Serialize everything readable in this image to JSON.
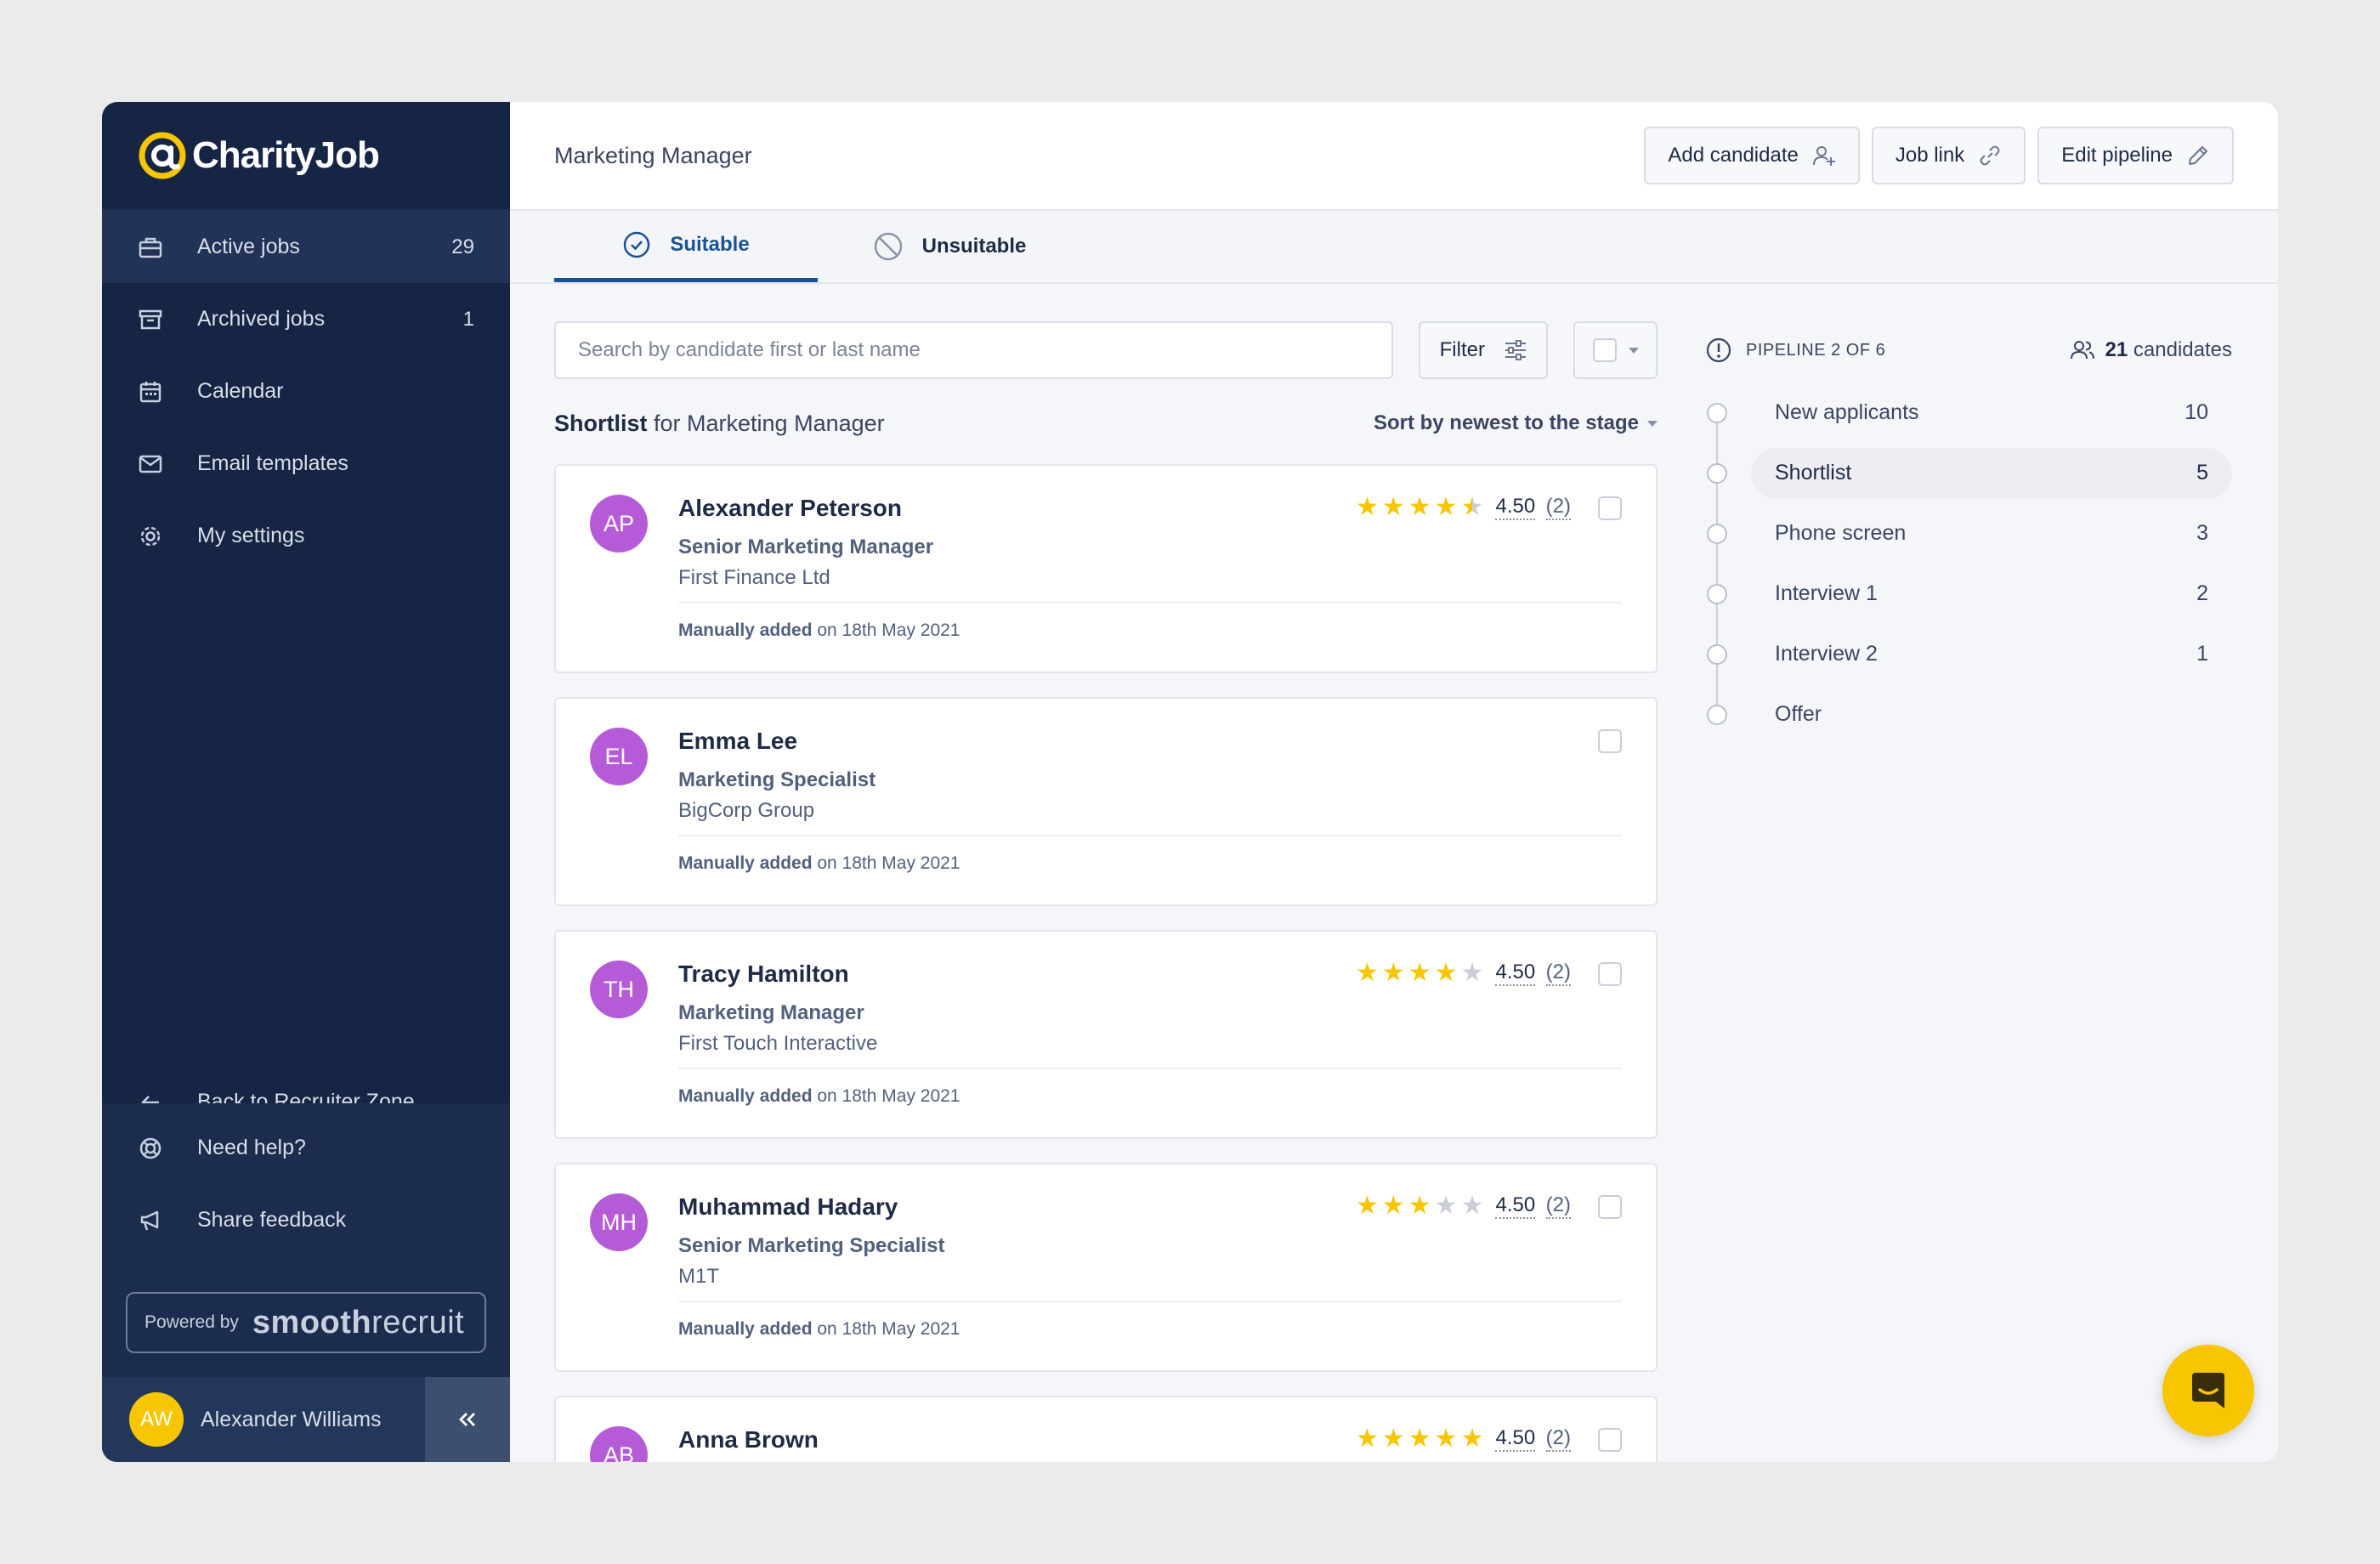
{
  "brand": {
    "name": "CharityJob"
  },
  "sidebar": {
    "items": [
      {
        "label": "Active jobs",
        "count": "29",
        "icon": "briefcase-icon"
      },
      {
        "label": "Archived jobs",
        "count": "1",
        "icon": "archive-icon"
      },
      {
        "label": "Calendar",
        "count": "",
        "icon": "calendar-icon"
      },
      {
        "label": "Email templates",
        "count": "",
        "icon": "mail-icon"
      },
      {
        "label": "My settings",
        "count": "",
        "icon": "gear-icon"
      }
    ],
    "back_label": "Back to Recruiter Zone",
    "help_label": "Need help?",
    "feedback_label": "Share feedback",
    "powered_label": "Powered by",
    "powered_brand_bold": "smooth",
    "powered_brand_light": "recruit",
    "user": {
      "initials": "AW",
      "name": "Alexander Williams"
    }
  },
  "header": {
    "title": "Marketing Manager",
    "buttons": {
      "add_candidate": "Add candidate",
      "job_link": "Job link",
      "edit_pipeline": "Edit pipeline"
    }
  },
  "tabs": [
    {
      "label": "Suitable",
      "icon": "check-circle-icon"
    },
    {
      "label": "Unsuitable",
      "icon": "ban-icon"
    }
  ],
  "search": {
    "placeholder": "Search by candidate first or last name",
    "value": ""
  },
  "filter_label": "Filter",
  "list": {
    "title_bold": "Shortlist",
    "title_rest": " for Marketing Manager",
    "sort_label": "Sort by newest to the stage"
  },
  "candidates": [
    {
      "initials": "AP",
      "name": "Alexander Peterson",
      "role": "Senior Marketing Manager",
      "company": "First Finance Ltd",
      "added_bold": "Manually added",
      "added_rest": " on 18th May 2021",
      "stars": 4.5,
      "rating": "4.50",
      "rating_count": "(2)"
    },
    {
      "initials": "EL",
      "name": "Emma Lee",
      "role": "Marketing Specialist",
      "company": "BigCorp Group",
      "added_bold": "Manually added",
      "added_rest": " on 18th May 2021",
      "stars": 0,
      "rating": "",
      "rating_count": ""
    },
    {
      "initials": "TH",
      "name": "Tracy Hamilton",
      "role": "Marketing Manager",
      "company": "First Touch Interactive",
      "added_bold": "Manually added",
      "added_rest": " on 18th May 2021",
      "stars": 4,
      "rating": "4.50",
      "rating_count": "(2)"
    },
    {
      "initials": "MH",
      "name": "Muhammad Hadary",
      "role": "Senior Marketing Specialist",
      "company": "M1T",
      "added_bold": "Manually added",
      "added_rest": " on 18th May 2021",
      "stars": 3,
      "rating": "4.50",
      "rating_count": "(2)"
    },
    {
      "initials": "AB",
      "name": "Anna Brown",
      "role": "",
      "company": "",
      "added_bold": "",
      "added_rest": "",
      "stars": 5,
      "rating": "4.50",
      "rating_count": "(2)"
    }
  ],
  "pipeline": {
    "label": "PIPELINE 2 OF 6",
    "candidates_count": "21",
    "candidates_label": " candidates",
    "stages": [
      {
        "name": "New applicants",
        "count": "10",
        "active": false
      },
      {
        "name": "Shortlist",
        "count": "5",
        "active": true
      },
      {
        "name": "Phone screen",
        "count": "3",
        "active": false
      },
      {
        "name": "Interview 1",
        "count": "2",
        "active": false
      },
      {
        "name": "Interview 2",
        "count": "1",
        "active": false
      },
      {
        "name": "Offer",
        "count": "",
        "active": false
      }
    ]
  },
  "colors": {
    "sidebar": "#162544",
    "accent": "#1a5296",
    "star": "#f7c600",
    "avatar": "#b65bd8"
  }
}
